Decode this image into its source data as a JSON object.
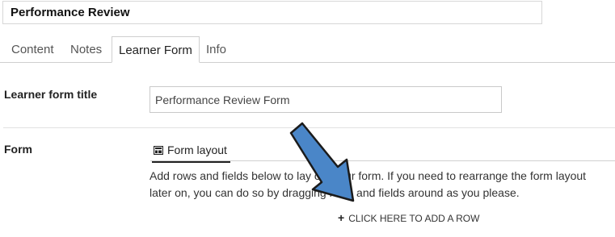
{
  "header": {
    "title_value": "Performance Review"
  },
  "tabs": [
    {
      "label": "Content"
    },
    {
      "label": "Notes"
    },
    {
      "label": "Learner Form",
      "active": true
    },
    {
      "label": "Info"
    }
  ],
  "learner_form_title": {
    "label": "Learner form title",
    "value": "Performance Review Form"
  },
  "form": {
    "label": "Form",
    "layout_tab_label": "Form layout",
    "layout_icon": "form-layout-icon",
    "help_text": "Add rows and fields below to lay out your form. If you need to rearrange the form layout later on, you can do so by dragging rows and fields around as you please.",
    "add_row_label": "CLICK HERE TO ADD A ROW",
    "add_row_icon": "plus-icon"
  },
  "annotation": {
    "arrow_color": "#4a86c8"
  }
}
